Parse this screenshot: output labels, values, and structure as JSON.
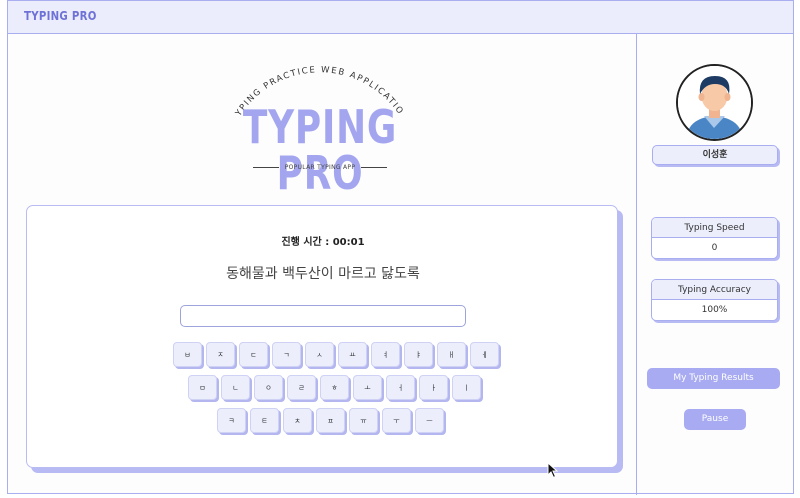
{
  "app": {
    "brand": "TYPING PRO"
  },
  "logo": {
    "arc_text": "TYPING PRACTICE WEB APPLICATION",
    "title": "TYPING PRO",
    "subtitle": "POPULAR TYPING APP"
  },
  "practice": {
    "timer": "진행 시간 : 00:01",
    "sentence": "동해물과 백두산이 마르고 닳도록",
    "input_value": ""
  },
  "keyboard": {
    "row1": [
      "ㅂ",
      "ㅈ",
      "ㄷ",
      "ㄱ",
      "ㅅ",
      "ㅛ",
      "ㅕ",
      "ㅑ",
      "ㅐ",
      "ㅔ"
    ],
    "row2": [
      "ㅁ",
      "ㄴ",
      "ㅇ",
      "ㄹ",
      "ㅎ",
      "ㅗ",
      "ㅓ",
      "ㅏ",
      "ㅣ"
    ],
    "row3": [
      "ㅋ",
      "ㅌ",
      "ㅊ",
      "ㅍ",
      "ㅠ",
      "ㅜ",
      "ㅡ"
    ]
  },
  "profile": {
    "name": "이성훈",
    "avatar_icon": "user-avatar-icon"
  },
  "stats": {
    "speed_label": "Typing Speed",
    "speed_value": "0",
    "accuracy_label": "Typing Accuracy",
    "accuracy_value": "100%"
  },
  "actions": {
    "results_label": "My Typing Results",
    "pause_label": "Pause"
  },
  "colors": {
    "accent": "#a8abf1",
    "border": "#a9aef0",
    "header_bg": "#ebedfd",
    "logo": "#a3a6ef"
  }
}
